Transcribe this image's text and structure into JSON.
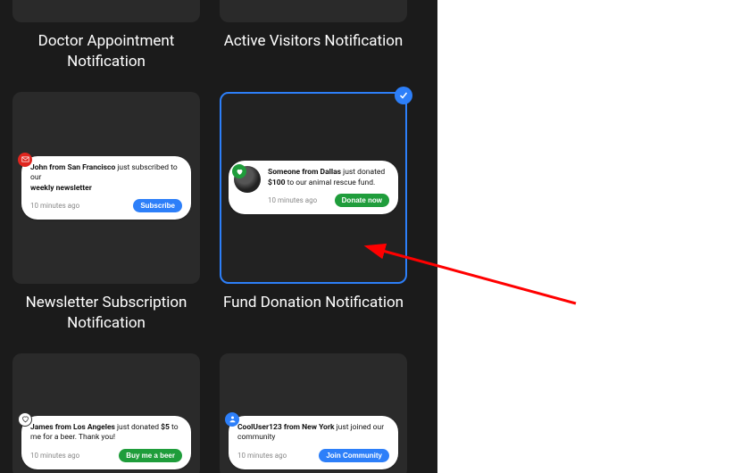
{
  "templates": {
    "doctor": {
      "title": "Doctor Appointment Notification"
    },
    "visitors": {
      "title": "Active Visitors Notification"
    },
    "newsletter": {
      "title": "Newsletter Subscription Notification",
      "line1_bold": "John from San Francisco",
      "line1_rest": " just subscribed to our ",
      "line2_bold": "weekly newsletter",
      "time": "10 minutes ago",
      "button": "Subscribe",
      "badge_icon": "mail"
    },
    "donation": {
      "title": "Fund Donation Notification",
      "line1_bold": "Someone from Dallas",
      "line1_rest": " just donated ",
      "line2_bold": "$100",
      "line2_rest": " to our animal rescue fund.",
      "time": "10 minutes ago",
      "button": "Donate now",
      "badge_icon": "heart"
    },
    "beer": {
      "line1_bold": "James from Los Angeles",
      "line1_rest": " just donated ",
      "line1_bold2": "$5",
      "line1_rest2": " to me for a beer. Thank you!",
      "time": "10 minutes ago",
      "button": "Buy me a beer",
      "badge_icon": "heart-outline"
    },
    "community": {
      "line1_bold": "CoolUser123 from New York",
      "line1_rest": " just joined our community",
      "time": "10 minutes ago",
      "button": "Join Community",
      "badge_icon": "user"
    }
  },
  "selected": "donation"
}
